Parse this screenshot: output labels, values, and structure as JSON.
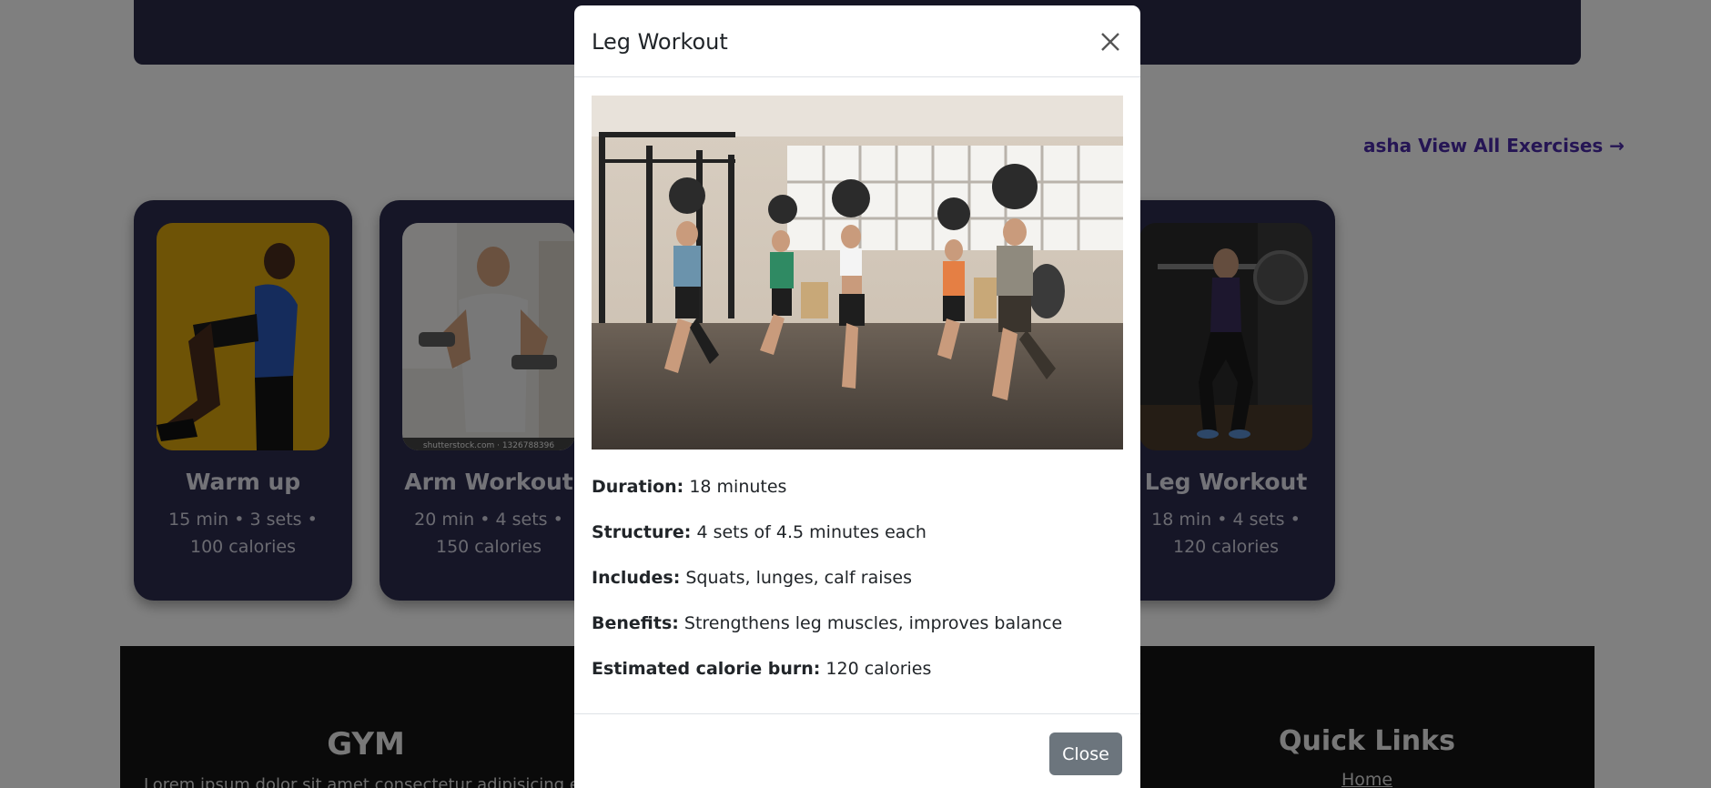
{
  "background": {
    "view_all_link": "asha View All Exercises →",
    "cards": [
      {
        "title": "Warm up",
        "meta": "15 min • 3 sets • 100 calories"
      },
      {
        "title": "Arm Workout",
        "meta": "20 min • 4 sets • 150 calories",
        "image_caption": "shutterstock.com · 1326788396"
      },
      {
        "title": "Leg Workout",
        "meta": "18 min • 4 sets • 120 calories"
      }
    ],
    "footer": {
      "brand": "GYM",
      "text": "Lorem ipsum dolor sit amet consectetur adipisicing el",
      "links_title": "Quick Links",
      "links": [
        "Home"
      ]
    }
  },
  "modal": {
    "title": "Leg Workout",
    "close_icon": "close-icon",
    "details": [
      {
        "label": "Duration:",
        "value": "18 minutes"
      },
      {
        "label": "Structure:",
        "value": "4 sets of 4.5 minutes each"
      },
      {
        "label": "Includes:",
        "value": "Squats, lunges, calf raises"
      },
      {
        "label": "Benefits:",
        "value": "Strengthens leg muscles, improves balance"
      },
      {
        "label": "Estimated calorie burn:",
        "value": "120 calories"
      }
    ],
    "close_button": "Close"
  },
  "colors": {
    "card_bg": "#2d2d4e",
    "link": "#4b2aa8",
    "secondary_button": "#6c757d"
  }
}
